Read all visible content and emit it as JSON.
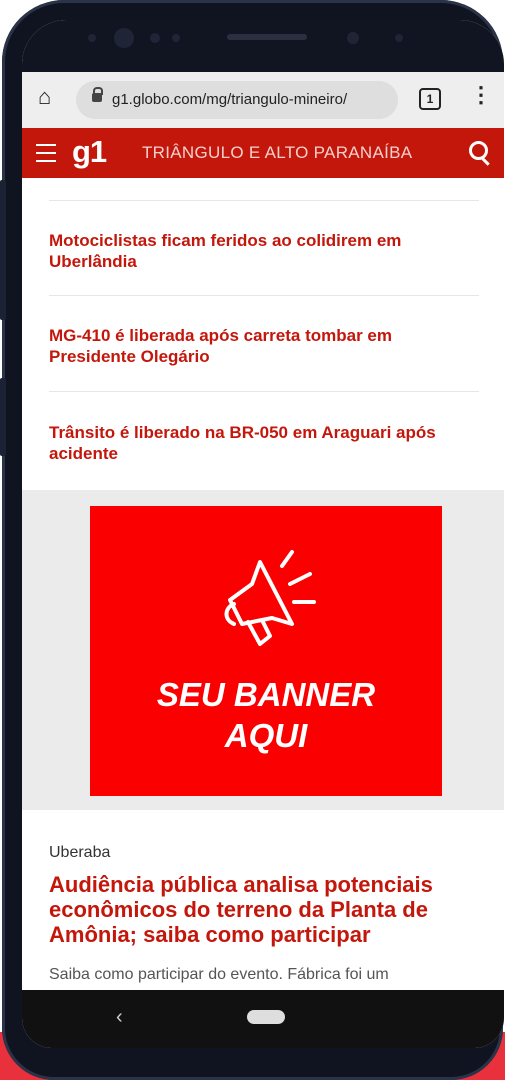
{
  "browser": {
    "url": "g1.globo.com/mg/triangulo-mineiro/",
    "tabs_count": "1"
  },
  "site": {
    "logo": "g1",
    "region": "TRIÂNGULO E ALTO PARANAÍBA"
  },
  "news_list": [
    {
      "title": "Motociclistas ficam feridos ao colidirem em Uberlândia"
    },
    {
      "title": "MG-410 é liberada após carreta tombar em Presidente Olegário"
    },
    {
      "title": "Trânsito é liberado na BR-050 em Araguari após acidente"
    }
  ],
  "ad": {
    "line1": "SEU BANNER",
    "line2": "AQUI"
  },
  "featured": {
    "kicker": "Uberaba",
    "headline": "Audiência pública analisa potenciais econômicos do terreno da Planta de Amônia; saiba como participar",
    "summary": "Saiba como participar do evento. Fábrica foi um"
  },
  "colors": {
    "brand_red": "#c4170c",
    "banner_red": "#fb0000",
    "strip_red": "#e8313d"
  },
  "icons": [
    "home-icon",
    "lock-icon",
    "tabs-icon",
    "menu-icon",
    "hamburger-icon",
    "search-icon",
    "megaphone-icon",
    "back-icon"
  ]
}
